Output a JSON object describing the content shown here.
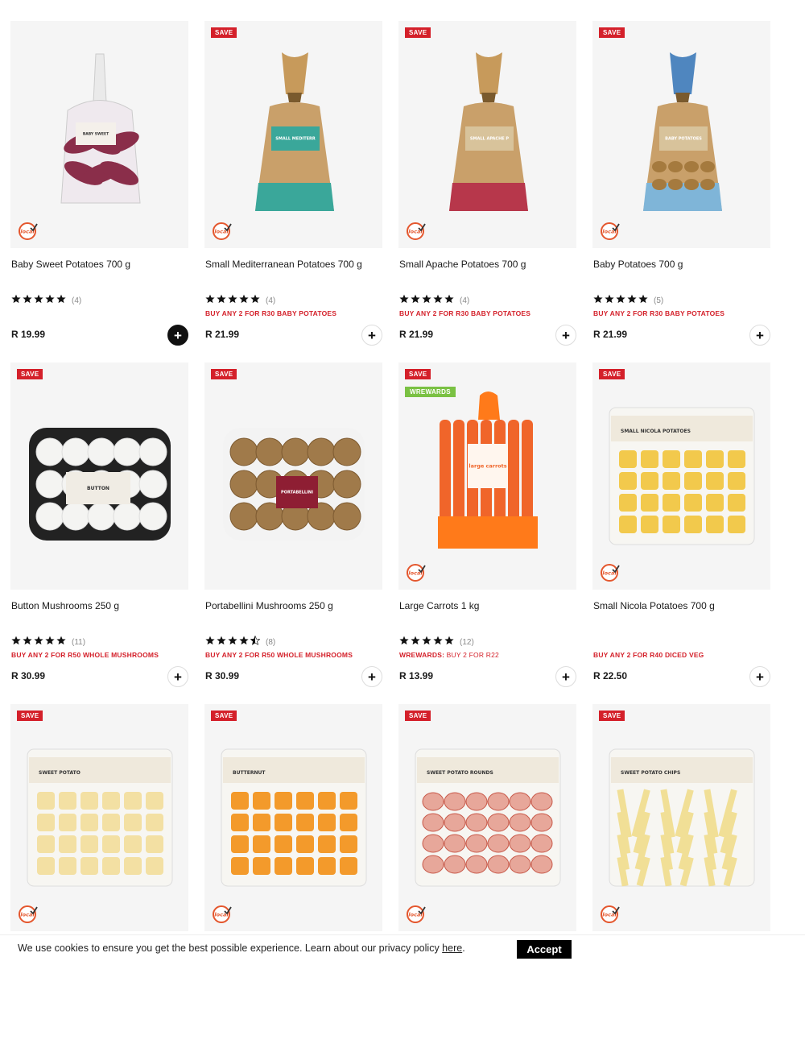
{
  "colors": {
    "save": "#d4202a",
    "wrewards": "#7ac143",
    "promo": "#d4202a",
    "image_bg": "#f5f5f5"
  },
  "products": [
    {
      "name": "Baby Sweet Potatoes 700 g",
      "save": false,
      "wrewards": false,
      "local": true,
      "rating": 5,
      "reviews": "(4)",
      "promo": "",
      "promo_light": "",
      "price": "R 19.99",
      "add_active": true,
      "image": "bag-purple"
    },
    {
      "name": "Small Mediterranean Potatoes 700 g",
      "save": true,
      "wrewards": false,
      "local": true,
      "rating": 5,
      "reviews": "(4)",
      "promo": "BUY ANY 2 FOR R30 BABY POTATOES",
      "promo_light": "",
      "price": "R 21.99",
      "add_active": false,
      "image": "sack-teal"
    },
    {
      "name": "Small Apache Potatoes 700 g",
      "save": true,
      "wrewards": false,
      "local": true,
      "rating": 5,
      "reviews": "(4)",
      "promo": "BUY ANY 2 FOR R30 BABY POTATOES",
      "promo_light": "",
      "price": "R 21.99",
      "add_active": false,
      "image": "sack-red"
    },
    {
      "name": "Baby Potatoes 700 g",
      "save": true,
      "wrewards": false,
      "local": true,
      "rating": 5,
      "reviews": "(5)",
      "promo": "BUY ANY 2 FOR R30 BABY POTATOES",
      "promo_light": "",
      "price": "R 21.99",
      "add_active": false,
      "image": "sack-blue"
    },
    {
      "name": "Button Mushrooms 250 g",
      "save": true,
      "wrewards": false,
      "local": false,
      "rating": 5,
      "reviews": "(11)",
      "promo": "BUY ANY 2 FOR R50 WHOLE MUSHROOMS",
      "promo_light": "",
      "price": "R 30.99",
      "add_active": false,
      "image": "tray-white"
    },
    {
      "name": "Portabellini Mushrooms 250 g",
      "save": true,
      "wrewards": false,
      "local": false,
      "rating": 4.5,
      "reviews": "(8)",
      "promo": "BUY ANY 2 FOR R50 WHOLE MUSHROOMS",
      "promo_light": "",
      "price": "R 30.99",
      "add_active": false,
      "image": "tray-brown"
    },
    {
      "name": "Large Carrots 1 kg",
      "save": true,
      "wrewards": true,
      "local": true,
      "rating": 5,
      "reviews": "(12)",
      "promo": "WREWARDS:",
      "promo_light": " BUY 2 FOR R22",
      "price": "R 13.99",
      "add_active": false,
      "image": "carrots"
    },
    {
      "name": "Small Nicola Potatoes 700 g",
      "save": true,
      "wrewards": false,
      "local": true,
      "rating": 0,
      "reviews": "",
      "promo": "BUY ANY 2 FOR R40 DICED VEG",
      "promo_light": "",
      "price": "R 22.50",
      "add_active": false,
      "image": "bag-yellow"
    },
    {
      "name": "",
      "save": true,
      "wrewards": false,
      "local": true,
      "rating": 0,
      "reviews": "",
      "promo": "",
      "promo_light": "",
      "price": "",
      "add_active": false,
      "image": "bag-cubes-pale"
    },
    {
      "name": "",
      "save": true,
      "wrewards": false,
      "local": true,
      "rating": 0,
      "reviews": "",
      "promo": "",
      "promo_light": "",
      "price": "",
      "add_active": false,
      "image": "bag-cubes-orange"
    },
    {
      "name": "",
      "save": true,
      "wrewards": false,
      "local": true,
      "rating": 0,
      "reviews": "",
      "promo": "",
      "promo_light": "",
      "price": "",
      "add_active": false,
      "image": "bag-rounds"
    },
    {
      "name": "",
      "save": true,
      "wrewards": false,
      "local": true,
      "rating": 0,
      "reviews": "",
      "promo": "",
      "promo_light": "",
      "price": "",
      "add_active": false,
      "image": "bag-chips"
    }
  ],
  "badges": {
    "save_label": "SAVE",
    "wrewards_label": "WREWARDS"
  },
  "pack_labels": {
    "bag-purple": "BABY SWEET POTATOES",
    "sack-teal": "SMALL MEDITERRANEAN POTATOES",
    "sack-red": "SMALL APACHE POTATOES",
    "sack-blue": "BABY POTATOES",
    "tray-white": "BUTTON MUSHROOMS",
    "tray-brown": "PORTABELLINI MUSHROOMS",
    "carrots": "large carrots",
    "bag-yellow": "SMALL NICOLA POTATOES",
    "bag-cubes-pale": "SWEET POTATO",
    "bag-cubes-orange": "BUTTERNUT",
    "bag-rounds": "SWEET POTATO ROUNDS",
    "bag-chips": "SWEET POTATO CHIPS"
  },
  "cookie": {
    "message": "We use cookies to ensure you get the best possible experience. Learn about our privacy policy ",
    "link": "here",
    "suffix": ".",
    "accept": "Accept"
  }
}
